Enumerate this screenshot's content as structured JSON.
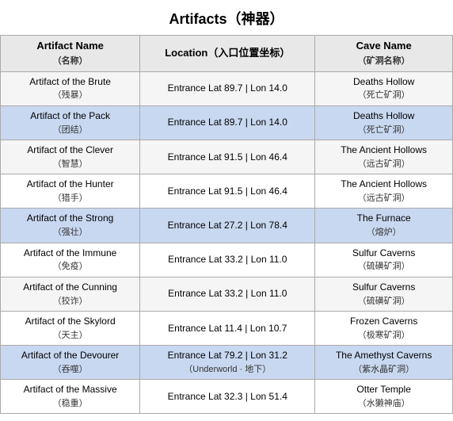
{
  "title": "Artifacts（神器）",
  "columns": [
    {
      "label": "Artifact Name",
      "sublabel": "（名称）"
    },
    {
      "label": "Location（入口位置坐标）",
      "sublabel": ""
    },
    {
      "label": "Cave Name",
      "sublabel": "（矿洞名称）"
    }
  ],
  "rows": [
    {
      "artifact": "Artifact of the Brute",
      "artifact_sub": "（残暴）",
      "location": "Entrance Lat 89.7 | Lon 14.0",
      "location_sub": "",
      "cave": "Deaths Hollow",
      "cave_sub": "（死亡矿洞）",
      "highlight": false
    },
    {
      "artifact": "Artifact of the Pack",
      "artifact_sub": "（团结）",
      "location": "Entrance Lat 89.7 | Lon 14.0",
      "location_sub": "",
      "cave": "Deaths Hollow",
      "cave_sub": "（死亡矿洞）",
      "highlight": true
    },
    {
      "artifact": "Artifact of the Clever",
      "artifact_sub": "（智慧）",
      "location": "Entrance Lat 91.5 | Lon 46.4",
      "location_sub": "",
      "cave": "The Ancient Hollows",
      "cave_sub": "（远古矿洞）",
      "highlight": false
    },
    {
      "artifact": "Artifact of the Hunter",
      "artifact_sub": "（猎手）",
      "location": "Entrance Lat 91.5 | Lon 46.4",
      "location_sub": "",
      "cave": "The Ancient Hollows",
      "cave_sub": "（远古矿洞）",
      "highlight": false
    },
    {
      "artifact": "Artifact of the Strong",
      "artifact_sub": "（强壮）",
      "location": "Entrance Lat 27.2 | Lon 78.4",
      "location_sub": "",
      "cave": "The Furnace",
      "cave_sub": "（熔炉）",
      "highlight": true
    },
    {
      "artifact": "Artifact of the Immune",
      "artifact_sub": "（免疫）",
      "location": "Entrance Lat 33.2 | Lon 11.0",
      "location_sub": "",
      "cave": "Sulfur Caverns",
      "cave_sub": "（硫磺矿洞）",
      "highlight": false
    },
    {
      "artifact": "Artifact of the Cunning",
      "artifact_sub": "（狡诈）",
      "location": "Entrance Lat 33.2 | Lon 11.0",
      "location_sub": "",
      "cave": "Sulfur Caverns",
      "cave_sub": "（硫磺矿洞）",
      "highlight": false
    },
    {
      "artifact": "Artifact of the Skylord",
      "artifact_sub": "（天主）",
      "location": "Entrance Lat 11.4 | Lon 10.7",
      "location_sub": "",
      "cave": "Frozen Caverns",
      "cave_sub": "（极寒矿洞）",
      "highlight": false
    },
    {
      "artifact": "Artifact of the Devourer",
      "artifact_sub": "（吞噬）",
      "location": "Entrance Lat 79.2 | Lon 31.2",
      "location_sub": "（Underworld · 地下）",
      "cave": "The Amethyst Caverns",
      "cave_sub": "（紫水晶矿洞）",
      "highlight": true
    },
    {
      "artifact": "Artifact of the Massive",
      "artifact_sub": "（稳重）",
      "location": "Entrance Lat 32.3 | Lon 51.4",
      "location_sub": "",
      "cave": "Otter Temple",
      "cave_sub": "（水獭神庙）",
      "highlight": false
    }
  ]
}
